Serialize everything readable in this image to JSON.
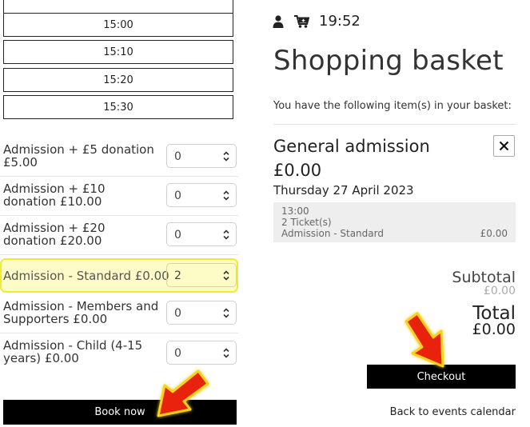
{
  "time_slots": [
    "15:00",
    "15:10",
    "15:20",
    "15:30"
  ],
  "tickets": [
    {
      "label": "Admission + £5 donation £5.00",
      "qty": "0"
    },
    {
      "label": "Admission + £10 donation £10.00",
      "qty": "0"
    },
    {
      "label": "Admission + £20 donation £20.00",
      "qty": "0"
    },
    {
      "label": "Admission - Standard £0.00",
      "qty": "2"
    },
    {
      "label": "Admission - Members and Supporters £0.00",
      "qty": "0"
    },
    {
      "label": "Admission - Child (4-15 years) £0.00",
      "qty": "0"
    }
  ],
  "book_now_label": "Book now",
  "header": {
    "user_icon": "user-icon",
    "cart_icon": "cart-icon",
    "time": "19:52"
  },
  "basket": {
    "title": "Shopping basket",
    "intro": "You have the following item(s) in your basket:",
    "item": {
      "name": "General admission",
      "price": "£0.00",
      "date": "Thursday 27 April 2023",
      "details": {
        "time": "13:00",
        "count": "2 Ticket(s)",
        "type": "Admission - Standard",
        "type_price": "£0.00"
      },
      "remove_icon": "close-icon"
    },
    "subtotal_label": "Subtotal",
    "subtotal_value": "£0.00",
    "total_label": "Total",
    "total_value": "£0.00",
    "checkout_label": "Checkout",
    "back_label": "Back to events calendar"
  },
  "colors": {
    "highlight_bg": "#fdfbc6",
    "highlight_border": "#f2ea34",
    "arrow_red": "#e8200c",
    "arrow_glow": "#f5d21a"
  }
}
